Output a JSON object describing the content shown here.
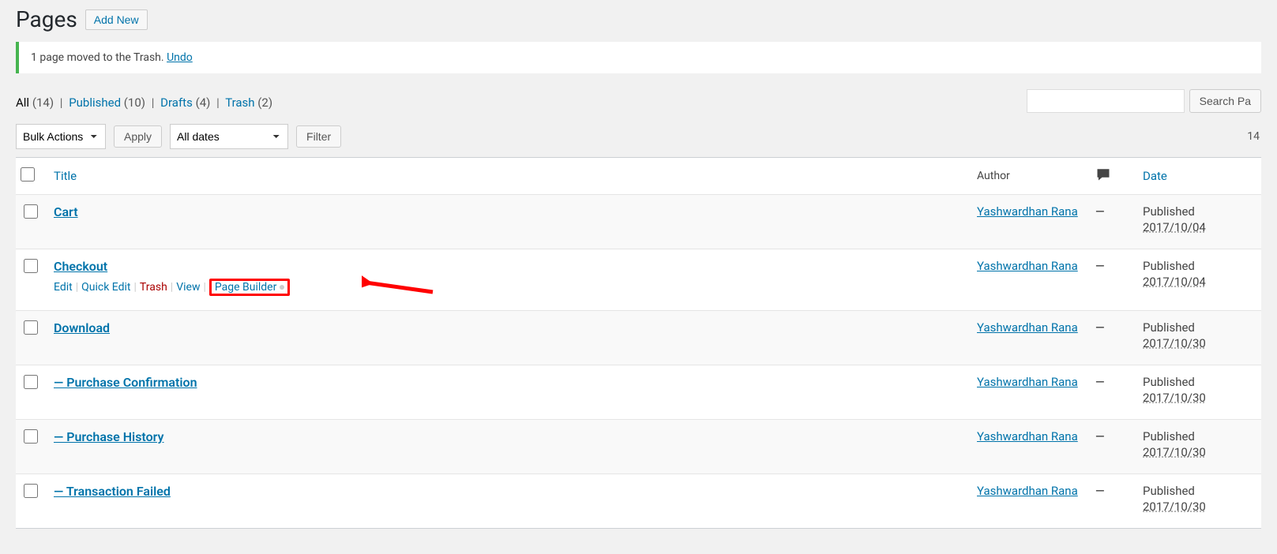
{
  "header": {
    "title": "Pages",
    "add_new": "Add New"
  },
  "notice": {
    "message": "1 page moved to the Trash. ",
    "undo": "Undo"
  },
  "filters": {
    "all": {
      "label": "All",
      "count": "(14)"
    },
    "published": {
      "label": "Published",
      "count": "(10)"
    },
    "drafts": {
      "label": "Drafts",
      "count": "(4)"
    },
    "trash": {
      "label": "Trash",
      "count": "(2)"
    }
  },
  "search_btn": "Search Pa",
  "bulk_actions": "Bulk Actions",
  "apply": "Apply",
  "all_dates": "All dates",
  "filter_btn": "Filter",
  "items_label": "14",
  "columns": {
    "title": "Title",
    "author": "Author",
    "date": "Date"
  },
  "row_actions": {
    "edit": "Edit",
    "quick_edit": "Quick Edit",
    "trash": "Trash",
    "view": "View",
    "page_builder": "Page Builder"
  },
  "pages": [
    {
      "title": "Cart",
      "prefix": "",
      "author": "Yashwardhan Rana",
      "comments": "—",
      "status": "Published",
      "date": "2017/10/04",
      "show_actions": false
    },
    {
      "title": "Checkout",
      "prefix": "",
      "author": "Yashwardhan Rana",
      "comments": "—",
      "status": "Published",
      "date": "2017/10/04",
      "show_actions": true
    },
    {
      "title": "Download",
      "prefix": "",
      "author": "Yashwardhan Rana",
      "comments": "—",
      "status": "Published",
      "date": "2017/10/30",
      "show_actions": false
    },
    {
      "title": "Purchase Confirmation",
      "prefix": "— ",
      "author": "Yashwardhan Rana",
      "comments": "—",
      "status": "Published",
      "date": "2017/10/30",
      "show_actions": false
    },
    {
      "title": "Purchase History",
      "prefix": "— ",
      "author": "Yashwardhan Rana",
      "comments": "—",
      "status": "Published",
      "date": "2017/10/30",
      "show_actions": false
    },
    {
      "title": "Transaction Failed",
      "prefix": "— ",
      "author": "Yashwardhan Rana",
      "comments": "—",
      "status": "Published",
      "date": "2017/10/30",
      "show_actions": false
    }
  ]
}
